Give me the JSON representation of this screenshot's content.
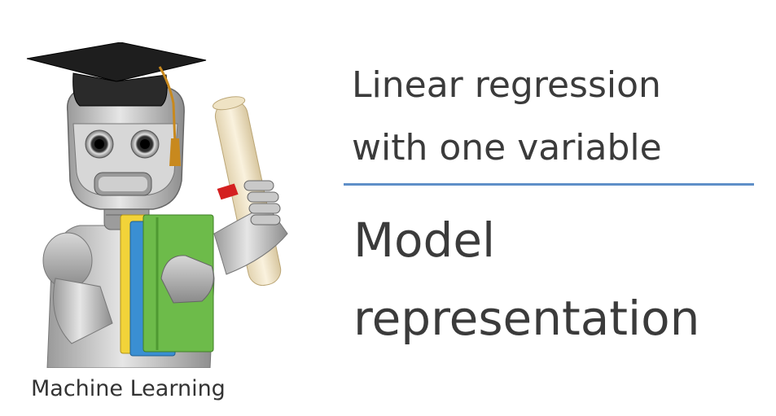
{
  "slide": {
    "title_lines": [
      "Linear regression",
      "with one variable"
    ],
    "subtitle_lines": [
      "Model",
      "representation"
    ],
    "course_label": "Machine Learning"
  },
  "colors": {
    "divider": "#5f8fc8",
    "text": "#3b3b3b"
  },
  "icons": {
    "mascot": "graduate-robot-illustration"
  }
}
